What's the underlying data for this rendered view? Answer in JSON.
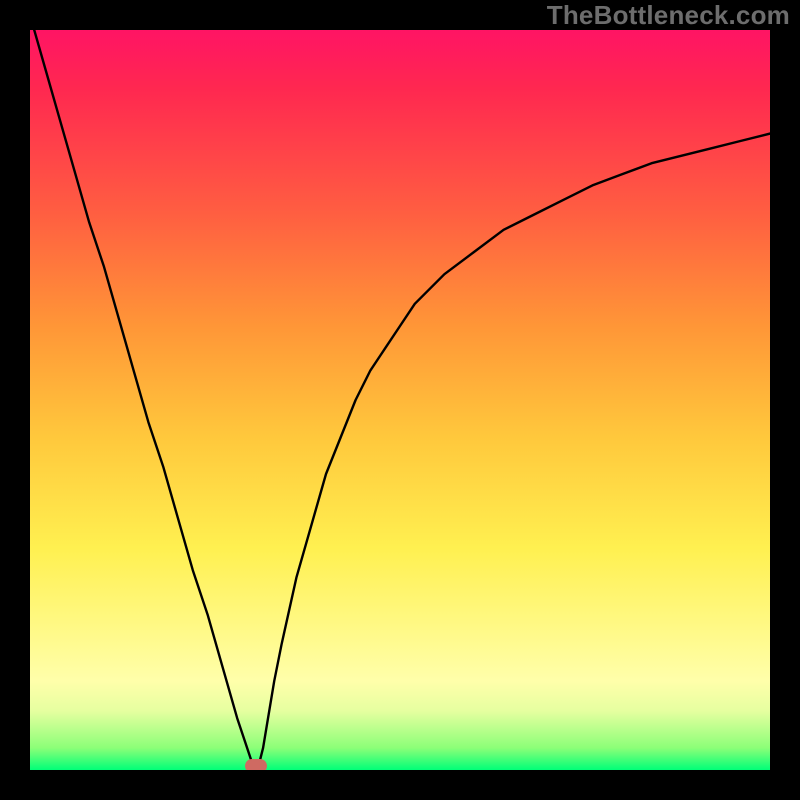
{
  "watermark": "TheBottleneck.com",
  "chart_data": {
    "type": "line",
    "title": "",
    "xlabel": "",
    "ylabel": "",
    "xlim": [
      0,
      100
    ],
    "ylim": [
      0,
      100
    ],
    "grid": false,
    "series": [
      {
        "name": "bottleneck-curve",
        "x": [
          0,
          2,
          4,
          6,
          8,
          10,
          12,
          14,
          16,
          18,
          20,
          22,
          24,
          26,
          28,
          29,
          30,
          30.5,
          31,
          31.5,
          32,
          33,
          34,
          36,
          38,
          40,
          42,
          44,
          46,
          48,
          50,
          52,
          56,
          60,
          64,
          68,
          72,
          76,
          80,
          84,
          88,
          92,
          96,
          100
        ],
        "y": [
          102,
          95,
          88,
          81,
          74,
          68,
          61,
          54,
          47,
          41,
          34,
          27,
          21,
          14,
          7,
          4,
          1,
          0,
          1,
          3,
          6,
          12,
          17,
          26,
          33,
          40,
          45,
          50,
          54,
          57,
          60,
          63,
          67,
          70,
          73,
          75,
          77,
          79,
          80.5,
          82,
          83,
          84,
          85,
          86
        ]
      }
    ],
    "annotations": [
      {
        "name": "minimum-marker",
        "x": 30.5,
        "y": 0.5
      }
    ]
  },
  "colors": {
    "curve": "#000000",
    "marker": "#cf6a62",
    "frame": "#000000",
    "watermark": "#6d6d6d"
  }
}
